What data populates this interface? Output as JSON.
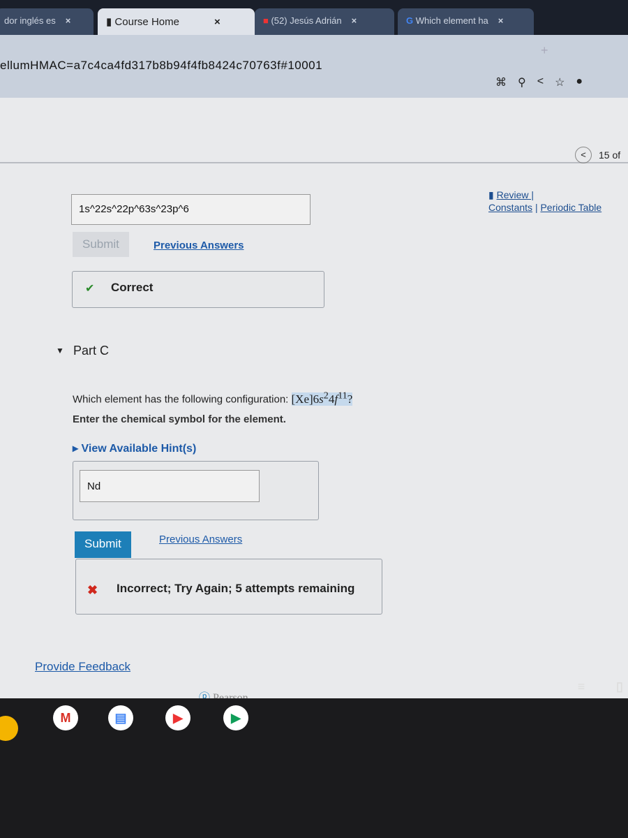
{
  "browser": {
    "tabs": [
      {
        "label": "dor inglés es",
        "icon": "page-icon"
      },
      {
        "label": "Course Home",
        "icon": "book-icon",
        "active": true
      },
      {
        "label": "(52) Jesús Adrián",
        "icon": "youtube-icon"
      },
      {
        "label": "Which element ha",
        "icon": "google-icon"
      }
    ],
    "new_tab": "+",
    "url": "ellumHMAC=a7c4ca4fd317b8b94f4fb8424c70763f#10001"
  },
  "nav": {
    "counter": "15 of",
    "prev": "<"
  },
  "resources": {
    "review": "Review |",
    "constants": "Constants",
    "sep": "|",
    "periodic_table": "Periodic Table"
  },
  "part_b": {
    "answer": "1s^22s^22p^63s^23p^6",
    "submit": "Submit",
    "previous_answers": "Previous Answers",
    "feedback": "Correct",
    "feedback_icon": "✔"
  },
  "part_c": {
    "title": "Part C",
    "question_prefix": "Which element has the following configuration:",
    "config": {
      "core": "[Xe]",
      "n1": "6",
      "s": "s",
      "e1": "2",
      "n2": "4",
      "f": "f",
      "e2": "11"
    },
    "question_suffix": "?",
    "instruction": "Enter the chemical symbol for the element.",
    "hint": "View Available Hint(s)",
    "answer": "Nd",
    "submit": "Submit",
    "previous_answers": "Previous Answers",
    "feedback_icon": "✖",
    "feedback": "Incorrect; Try Again; 5 attempts remaining"
  },
  "footer": {
    "provide_feedback": "Provide Feedback",
    "brand": "Pearson"
  },
  "colors": {
    "submit_active": "#1d7fb8",
    "link": "#1d5aa8",
    "correct": "#2a8a2a",
    "incorrect": "#d0281d"
  }
}
